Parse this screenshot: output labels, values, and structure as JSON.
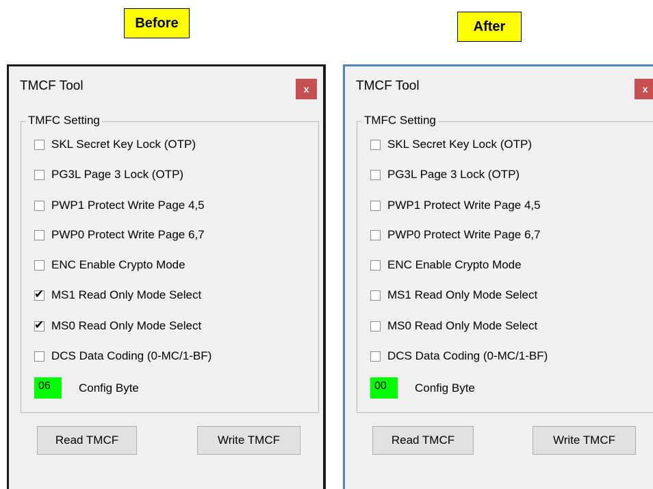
{
  "captions": {
    "before": "Before",
    "after": "After"
  },
  "dialogs": [
    {
      "title": "TMCF Tool",
      "close_label": "x",
      "group_label": "TMFC Setting",
      "options": [
        {
          "label": "SKL  Secret Key Lock (OTP)",
          "checked": false
        },
        {
          "label": "PG3L Page 3 Lock (OTP)",
          "checked": false
        },
        {
          "label": "PWP1 Protect Write Page 4,5",
          "checked": false
        },
        {
          "label": "PWP0 Protect Write Page 6,7",
          "checked": false
        },
        {
          "label": "ENC  Enable Crypto Mode",
          "checked": false
        },
        {
          "label": "MS1  Read Only Mode Select",
          "checked": true
        },
        {
          "label": "MS0  Read Only Mode Select",
          "checked": true
        },
        {
          "label": "DCS  Data Coding (0-MC/1-BF)",
          "checked": false
        }
      ],
      "config_value": "06",
      "config_label": "Config Byte",
      "read_button": "Read TMCF",
      "write_button": "Write TMCF"
    },
    {
      "title": "TMCF Tool",
      "close_label": "x",
      "group_label": "TMFC Setting",
      "options": [
        {
          "label": "SKL  Secret Key Lock (OTP)",
          "checked": false
        },
        {
          "label": "PG3L Page 3 Lock (OTP)",
          "checked": false
        },
        {
          "label": "PWP1 Protect Write Page 4,5",
          "checked": false
        },
        {
          "label": "PWP0 Protect Write Page 6,7",
          "checked": false
        },
        {
          "label": "ENC  Enable Crypto Mode",
          "checked": false
        },
        {
          "label": "MS1  Read Only Mode Select",
          "checked": false
        },
        {
          "label": "MS0  Read Only Mode Select",
          "checked": false
        },
        {
          "label": "DCS  Data Coding (0-MC/1-BF)",
          "checked": false
        }
      ],
      "config_value": "00",
      "config_label": "Config Byte",
      "read_button": "Read TMCF",
      "write_button": "Write TMCF"
    }
  ],
  "colors": {
    "caption_bg": "#ffff00",
    "config_bg": "#00ff00",
    "close_bg": "#c75050",
    "dialog_bg": "#f0f0f0"
  }
}
